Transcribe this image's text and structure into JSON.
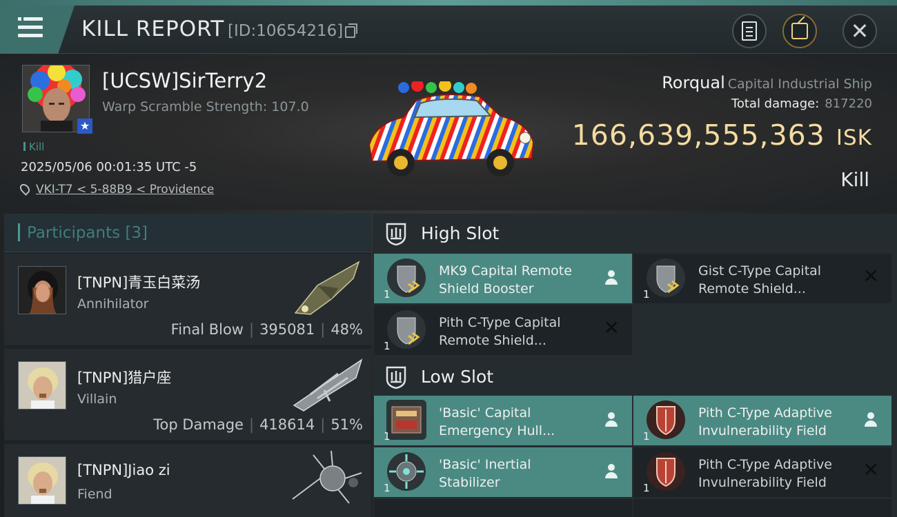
{
  "header": {
    "title": "KILL REPORT",
    "report_id": "[ID:10654216]"
  },
  "victim": {
    "name": "[UCSW]SirTerry2",
    "warp": "Warp Scramble Strength: 107.0",
    "kill_tag": "Kill",
    "datetime": "2025/05/06 00:01:35 UTC -5",
    "location": "VKI-T7 < 5-88B9 < Providence",
    "ship_name": "Rorqual",
    "ship_class": "Capital Industrial Ship",
    "total_damage_label": "Total damage:",
    "total_damage": "817220",
    "isk_value": "166,639,555,363",
    "isk_unit": "ISK",
    "result": "Kill"
  },
  "participants": {
    "tab_label": "Participants [3]",
    "rows": [
      {
        "name": "[TNPN]青玉白菜汤",
        "ship": "Annihilator",
        "role": "Final Blow",
        "damage": "395081",
        "percent": "48%"
      },
      {
        "name": "[TNPN]猎户座",
        "ship": "Villain",
        "role": "Top Damage",
        "damage": "418614",
        "percent": "51%"
      },
      {
        "name": "[TNPN]Jiao zi",
        "ship": "Fiend"
      }
    ]
  },
  "slots": {
    "high_label": "High Slot",
    "low_label": "Low Slot",
    "high": [
      {
        "qty": "1",
        "name": "MK9 Capital Remote Shield Booster",
        "state": "dropped"
      },
      {
        "qty": "1",
        "name": "Gist C-Type Capital Remote Shield...",
        "state": "destroyed"
      },
      {
        "qty": "1",
        "name": "Pith C-Type Capital Remote Shield...",
        "state": "destroyed"
      }
    ],
    "low": [
      {
        "qty": "1",
        "name": "'Basic' Capital Emergency Hull...",
        "state": "dropped"
      },
      {
        "qty": "1",
        "name": "Pith C-Type Adaptive Invulnerability Field",
        "state": "dropped"
      },
      {
        "qty": "1",
        "name": "'Basic' Inertial Stabilizer",
        "state": "dropped"
      },
      {
        "qty": "1",
        "name": "Pith C-Type Adaptive Invulnerability Field",
        "state": "destroyed"
      }
    ]
  },
  "colors": {
    "accent": "#4a8a83",
    "isk": "#f4dba0",
    "badge": "#2b59c7"
  }
}
